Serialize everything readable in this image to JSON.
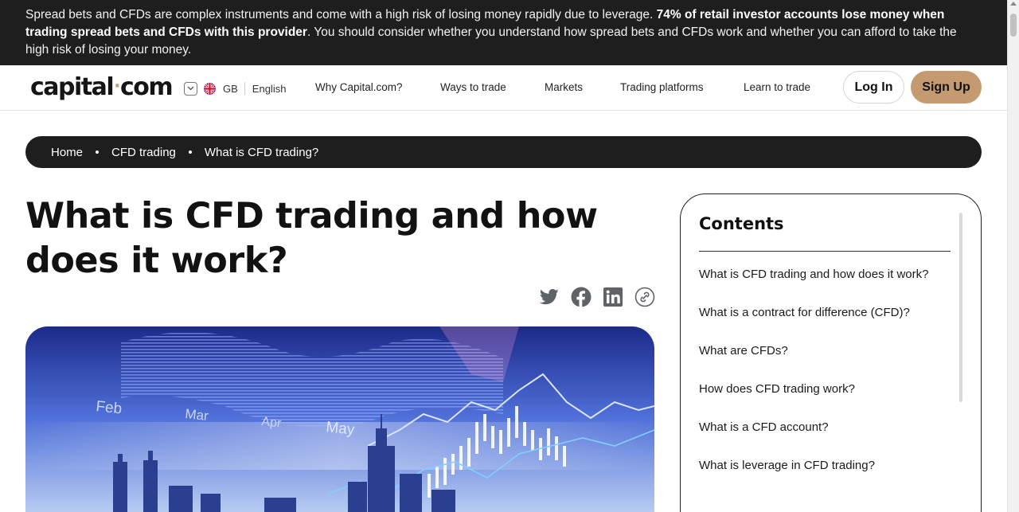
{
  "risk_warning": {
    "text_before": "Spread bets and CFDs are complex instruments and come with a high risk of losing money rapidly due to leverage. ",
    "text_bold": "74% of retail investor accounts lose money when trading spread bets and CFDs with this provider",
    "text_after": ". You should consider whether you understand how spread bets and CFDs work and whether you can afford to take the high risk of losing your money."
  },
  "header": {
    "logo_left": "capital",
    "logo_dot": "·",
    "logo_right": "com",
    "region": "GB",
    "language": "English",
    "nav": [
      "Why Capital.com?",
      "Ways to trade",
      "Markets",
      "Trading platforms",
      "Learn to trade"
    ],
    "login_label": "Log In",
    "signup_label": "Sign Up"
  },
  "breadcrumb": [
    "Home",
    "CFD trading",
    "What is CFD trading?"
  ],
  "article": {
    "title": "What is CFD trading and how does it work?",
    "share_icons": [
      "twitter-icon",
      "facebook-icon",
      "linkedin-icon",
      "copy-link-icon"
    ],
    "hero_labels": [
      "Feb",
      "Mar",
      "Apr",
      "May"
    ]
  },
  "toc": {
    "title": "Contents",
    "items": [
      "What is CFD trading and how does it work?",
      "What is a contract for difference (CFD)?",
      "What are CFDs?",
      "How does CFD trading work?",
      "What is a CFD account?",
      "What is leverage in CFD trading?"
    ]
  },
  "colors": {
    "dark": "#1e1e1e",
    "brand_accent": "#c59a71",
    "icon_grey": "#5f6368"
  }
}
